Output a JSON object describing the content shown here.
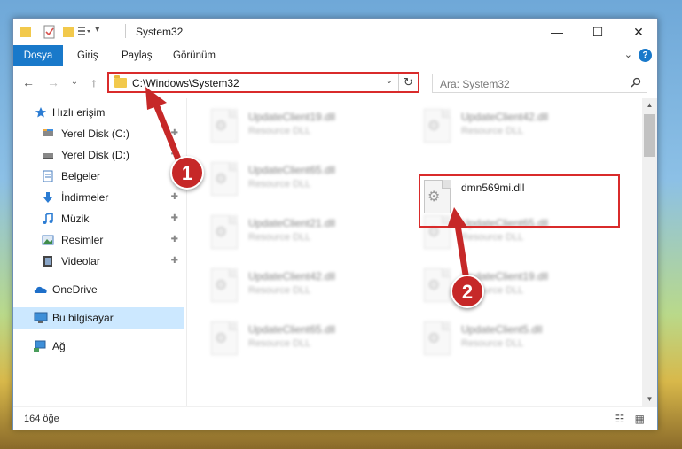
{
  "window": {
    "title": "System32",
    "minimize_glyph": "—",
    "maximize_glyph": "☐",
    "close_glyph": "✕"
  },
  "ribbon": {
    "tabs": [
      "Dosya",
      "Giriş",
      "Paylaş",
      "Görünüm"
    ],
    "expand_glyph": "⌄",
    "help_glyph": "?"
  },
  "navigation": {
    "back_glyph": "←",
    "forward_glyph": "→",
    "recent_glyph": "⌄",
    "up_glyph": "↑"
  },
  "address": {
    "path": "C:\\Windows\\System32",
    "dropdown_glyph": "⌄",
    "refresh_glyph": "↻"
  },
  "search": {
    "placeholder": "Ara: System32",
    "icon": "search-icon"
  },
  "sidebar": {
    "items": [
      {
        "label": "Hızlı erişim",
        "icon": "star-icon"
      },
      {
        "label": "Yerel Disk (C:)",
        "icon": "drive-icon",
        "pinned": true
      },
      {
        "label": "Yerel Disk (D:)",
        "icon": "drive-icon",
        "pinned": true
      },
      {
        "label": "Belgeler",
        "icon": "documents-icon",
        "pinned": true
      },
      {
        "label": "İndirmeler",
        "icon": "download-icon",
        "pinned": true
      },
      {
        "label": "Müzik",
        "icon": "music-icon",
        "pinned": true
      },
      {
        "label": "Resimler",
        "icon": "pictures-icon",
        "pinned": true
      },
      {
        "label": "Videolar",
        "icon": "videos-icon",
        "pinned": true
      },
      {
        "label": "OneDrive",
        "icon": "cloud-icon"
      },
      {
        "label": "Bu bilgisayar",
        "icon": "computer-icon",
        "selected": true
      },
      {
        "label": "Ağ",
        "icon": "network-icon"
      }
    ],
    "pin_glyph": "📌"
  },
  "files": [
    {
      "name": "UpdateClient19.dll",
      "type": "Resource DLL"
    },
    {
      "name": "UpdateClient42.dll",
      "type": "Resource DLL"
    },
    {
      "name": "UpdateClient65.dll",
      "type": "Resource DLL"
    },
    {
      "name": "dmn569mi.dll",
      "type": ""
    },
    {
      "name": "UpdateClient21.dll",
      "type": "Resource DLL"
    },
    {
      "name": "UpdateClient65.dll",
      "type": "Resource DLL"
    },
    {
      "name": "UpdateClient42.dll",
      "type": "Resource DLL"
    },
    {
      "name": "UpdateClient19.dll",
      "type": "Resource DLL"
    },
    {
      "name": "UpdateClient65.dll",
      "type": "Resource DLL"
    },
    {
      "name": "UpdateClient5.dll",
      "type": "Resource DLL"
    }
  ],
  "status": {
    "count": "164 öğe",
    "views_glyph": "☷ ▦"
  },
  "annotations": {
    "badge1": "1",
    "badge2": "2",
    "color": "#d92b2b"
  },
  "colors": {
    "accent": "#1979ca",
    "selection": "#cce8ff",
    "highlight": "#d92b2b"
  }
}
